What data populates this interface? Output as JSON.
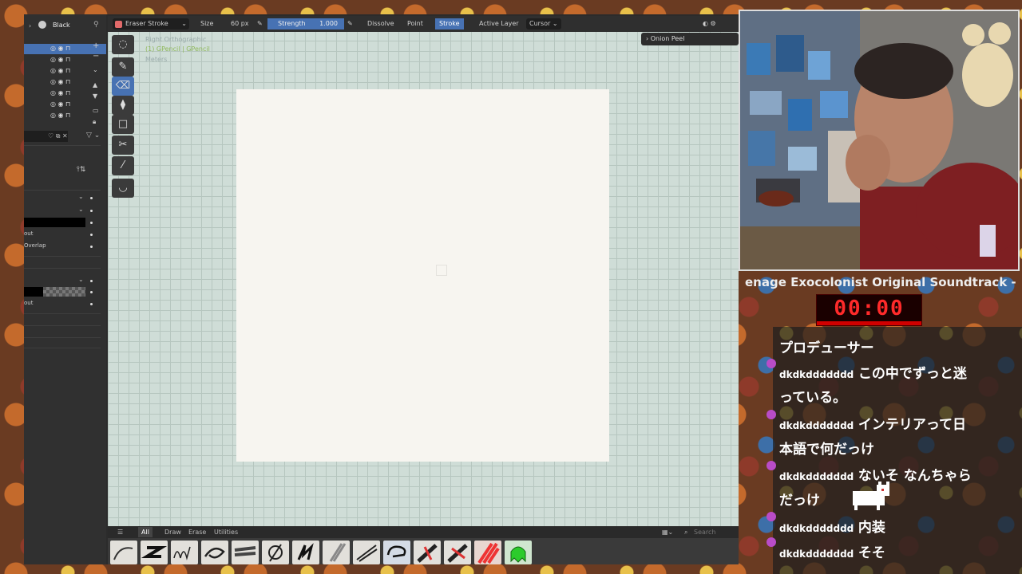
{
  "layers_panel": {
    "active_layer": "Black",
    "overlap_label": "Overlap",
    "out_label_1": "out",
    "out_label_2": "out"
  },
  "header": {
    "tool": "Eraser Stroke",
    "size_label": "Size",
    "size_value": "60 px",
    "strength_label": "Strength",
    "strength_value": "1.000",
    "mode_dissolve": "Dissolve",
    "mode_point": "Point",
    "mode_stroke": "Stroke",
    "active_layer": "Active Layer",
    "cursor": "Cursor"
  },
  "viewport": {
    "view_name": "Right Orthographic",
    "object_name": "(1) GPencil | GPencil",
    "units": "Meters",
    "onion_peel": "Onion Peel"
  },
  "asset_bar": {
    "tabs": [
      "All",
      "Draw",
      "Erase",
      "Utilities"
    ],
    "search_placeholder": "Search"
  },
  "stream": {
    "now_playing": "enage Exocolonist Original Soundtrack -",
    "timer": "00:00",
    "chat": [
      {
        "user": "",
        "text": "プロデューサー"
      },
      {
        "user": "dkdkddddddd",
        "text": "この中でずっと迷"
      },
      {
        "user": "",
        "text": "っている。"
      },
      {
        "user": "dkdkddddddd",
        "text": "インテリアって日"
      },
      {
        "user": "",
        "text": "本語で何だっけ"
      },
      {
        "user": "dkdkddddddd",
        "text": "ないそ なんちゃら"
      },
      {
        "user": "",
        "text": "だっけ"
      },
      {
        "user": "dkdkddddddd",
        "text": "内装"
      },
      {
        "user": "dkdkddddddd",
        "text": "そそ"
      }
    ]
  },
  "colors": {
    "accent": "#4772b3",
    "viewport_bg": "#cfddd7",
    "canvas": "#f7f5f0",
    "timer_red": "#ff2a2a",
    "badge": "#b94cc8"
  }
}
